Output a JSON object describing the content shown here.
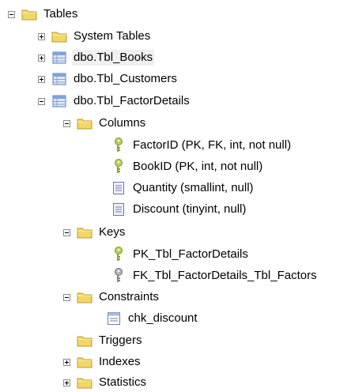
{
  "tree": {
    "tables": "Tables",
    "system_tables": "System Tables",
    "tbl_books": "dbo.Tbl_Books",
    "tbl_customers": "dbo.Tbl_Customers",
    "tbl_factordetails": "dbo.Tbl_FactorDetails",
    "columns": "Columns",
    "col_factorid": "FactorID (PK, FK, int, not null)",
    "col_bookid": "BookID (PK, int, not null)",
    "col_quantity": "Quantity (smallint, null)",
    "col_discount": "Discount (tinyint, null)",
    "keys": "Keys",
    "key_pk": "PK_Tbl_FactorDetails",
    "key_fk": "FK_Tbl_FactorDetails_Tbl_Factors",
    "constraints": "Constraints",
    "chk_discount": "chk_discount",
    "triggers": "Triggers",
    "indexes": "Indexes",
    "statistics": "Statistics"
  },
  "icons": {
    "folder": "folder-icon",
    "table": "table-icon",
    "column": "column-icon",
    "primary_key": "primary-key-icon",
    "foreign_key": "foreign-key-icon",
    "constraint": "constraint-icon"
  },
  "colors": {
    "folder": "#f3d766",
    "table": "#7fa4d8",
    "key_green": "#b8d05a",
    "key_gray": "#9a9a9a"
  }
}
